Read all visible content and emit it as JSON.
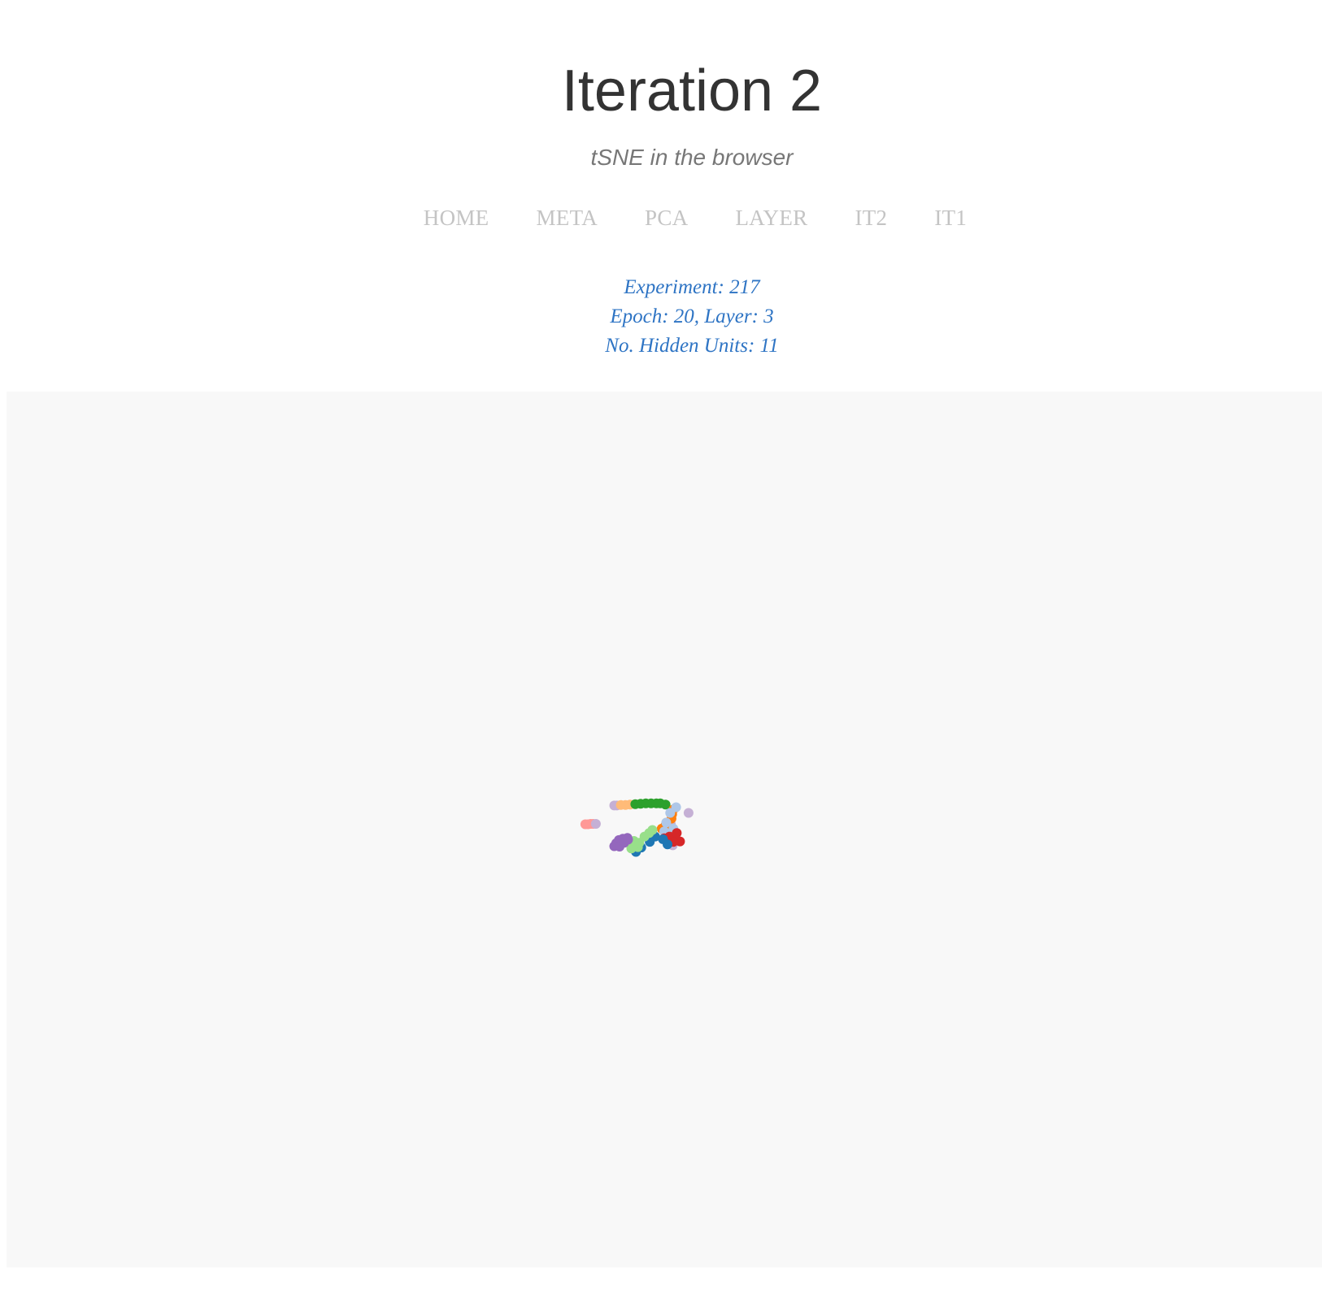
{
  "header": {
    "title": "Iteration 2",
    "subtitle": "tSNE in the browser"
  },
  "nav": {
    "items": [
      {
        "label": "HOME"
      },
      {
        "label": "META"
      },
      {
        "label": "PCA"
      },
      {
        "label": "LAYER"
      },
      {
        "label": "IT2"
      },
      {
        "label": "IT1"
      }
    ]
  },
  "info": {
    "experiment": "Experiment: 217",
    "epoch_layer": "Epoch: 20, Layer: 3",
    "hidden_units": "No. Hidden Units: 11"
  },
  "colors": {
    "text_dark": "#333333",
    "subtitle": "#777777",
    "nav": "#c4c4c4",
    "info": "#2e74c4",
    "panel_bg": "#f8f8f8"
  },
  "chart_data": {
    "type": "scatter",
    "title": "",
    "xlabel": "",
    "ylabel": "",
    "grid": false,
    "xlim": [
      -100,
      100
    ],
    "ylim": [
      -100,
      100
    ],
    "series": [
      {
        "color": "#ff9896",
        "points": [
          [
            -12.0,
            1.2
          ],
          [
            -11.6,
            1.2
          ],
          [
            -11.2,
            1.3
          ],
          [
            -10.8,
            1.3
          ]
        ]
      },
      {
        "color": "#c5b0d5",
        "points": [
          [
            -7.6,
            5.5
          ],
          [
            -7.2,
            5.5
          ],
          [
            -10.4,
            1.3
          ],
          [
            1.0,
            1.2
          ],
          [
            3.7,
            3.8
          ],
          [
            1.3,
            -3.6
          ]
        ]
      },
      {
        "color": "#ffbb78",
        "points": [
          [
            -6.6,
            5.6
          ],
          [
            -5.9,
            5.6
          ],
          [
            -5.2,
            5.7
          ]
        ]
      },
      {
        "color": "#2ca02c",
        "points": [
          [
            -4.4,
            5.8
          ],
          [
            -3.6,
            5.9
          ],
          [
            -2.8,
            6.0
          ],
          [
            -2.0,
            6.0
          ],
          [
            -1.2,
            6.0
          ],
          [
            -0.6,
            6.0
          ],
          [
            0.2,
            5.7
          ]
        ]
      },
      {
        "color": "#ff7f0e",
        "points": [
          [
            1.4,
            4.6
          ],
          [
            1.2,
            3.5
          ],
          [
            1.1,
            2.5
          ],
          [
            0.2,
            1.0
          ],
          [
            -0.4,
            0.2
          ]
        ]
      },
      {
        "color": "#aec7e8",
        "points": [
          [
            1.8,
            5.1
          ],
          [
            0.9,
            3.8
          ],
          [
            1.4,
            0.2
          ],
          [
            0.0,
            -0.4
          ],
          [
            0.3,
            1.6
          ]
        ]
      },
      {
        "color": "#d62728",
        "points": [
          [
            0.8,
            -1.6
          ],
          [
            1.6,
            -2.1
          ],
          [
            2.4,
            -2.7
          ],
          [
            1.4,
            -2.8
          ],
          [
            0.6,
            -3.0
          ],
          [
            0.0,
            -2.0
          ],
          [
            1.9,
            -0.8
          ]
        ]
      },
      {
        "color": "#1f77b4",
        "points": [
          [
            -1.4,
            -1.6
          ],
          [
            -2.2,
            -2.8
          ],
          [
            -3.5,
            -4.1
          ],
          [
            -4.3,
            -5.1
          ],
          [
            0.5,
            -3.4
          ],
          [
            -0.2,
            -2.2
          ]
        ]
      },
      {
        "color": "#98df8a",
        "points": [
          [
            -4.0,
            -4.0
          ],
          [
            -4.5,
            -3.4
          ],
          [
            -5.0,
            -4.3
          ],
          [
            -4.6,
            -2.6
          ],
          [
            -3.8,
            -3.0
          ],
          [
            -3.0,
            -1.6
          ],
          [
            -2.3,
            -0.8
          ],
          [
            -1.8,
            -0.1
          ]
        ]
      },
      {
        "color": "#9467bd",
        "points": [
          [
            -5.6,
            -1.9
          ],
          [
            -6.3,
            -2.1
          ],
          [
            -6.9,
            -2.4
          ],
          [
            -7.3,
            -3.1
          ],
          [
            -7.6,
            -3.8
          ],
          [
            -6.8,
            -3.9
          ],
          [
            -6.1,
            -3.0
          ],
          [
            -5.5,
            -2.3
          ]
        ]
      }
    ]
  }
}
